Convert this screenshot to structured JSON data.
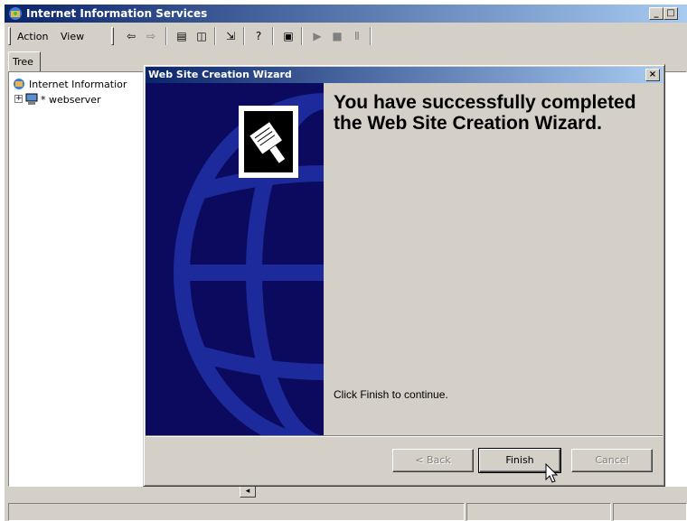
{
  "main_window": {
    "title": "Internet Information Services",
    "menu": {
      "action": "Action",
      "view": "View"
    },
    "tree_tab": "Tree",
    "tree_items": [
      {
        "label": "Internet Informatior"
      },
      {
        "label": "* webserver"
      }
    ]
  },
  "dialog": {
    "title": "Web Site Creation Wizard",
    "heading": "You have successfully completed the Web Site Creation Wizard.",
    "message": "Click Finish to continue.",
    "buttons": {
      "back": "< Back",
      "finish": "Finish",
      "cancel": "Cancel"
    }
  },
  "colors": {
    "titlebar_active": "#0a246a",
    "wizard_panel": "#0c0a5e",
    "window_face": "#d4d0c8"
  },
  "icons": [
    "iis-icon",
    "back-arrow-icon",
    "forward-arrow-icon",
    "computer-icon",
    "help-icon",
    "play-icon",
    "stop-icon",
    "pause-icon",
    "wizard-book-icon",
    "cursor-icon"
  ]
}
